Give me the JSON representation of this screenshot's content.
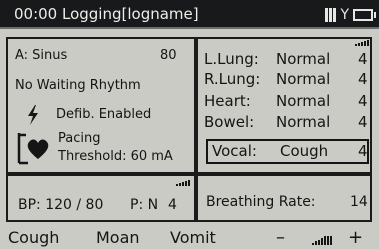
{
  "title_bar": {
    "text": "00:00 Logging[logname]",
    "icons": [
      "signal-strength-icon",
      "antenna-icon",
      "battery-icon"
    ]
  },
  "left_panel": {
    "rhythm_label": "A: Sinus",
    "rhythm_value": "80",
    "waiting_text": "No Waiting Rhythm",
    "defib_text": "Defib. Enabled",
    "pacing_label": "Pacing",
    "pacing_threshold": "Threshold: 60 mA"
  },
  "sounds_panel": {
    "rows": [
      {
        "name": "L.Lung:",
        "value": "Normal",
        "level": "4"
      },
      {
        "name": "R.Lung:",
        "value": "Normal",
        "level": "4"
      },
      {
        "name": "Heart:",
        "value": "Normal",
        "level": "4"
      },
      {
        "name": "Bowel:",
        "value": "Normal",
        "level": "4"
      }
    ],
    "vocal": {
      "name": "Vocal:",
      "value": "Cough",
      "level": "4"
    }
  },
  "bp_panel": {
    "text": "BP: 120 / 80",
    "pulse": "P: N",
    "level": "4"
  },
  "breathing_panel": {
    "label": "Breathing Rate:",
    "value": "14"
  },
  "bottom_bar": {
    "cough": "Cough",
    "moan": "Moan",
    "vomit": "Vomit",
    "minus": "–",
    "plus": "+"
  }
}
